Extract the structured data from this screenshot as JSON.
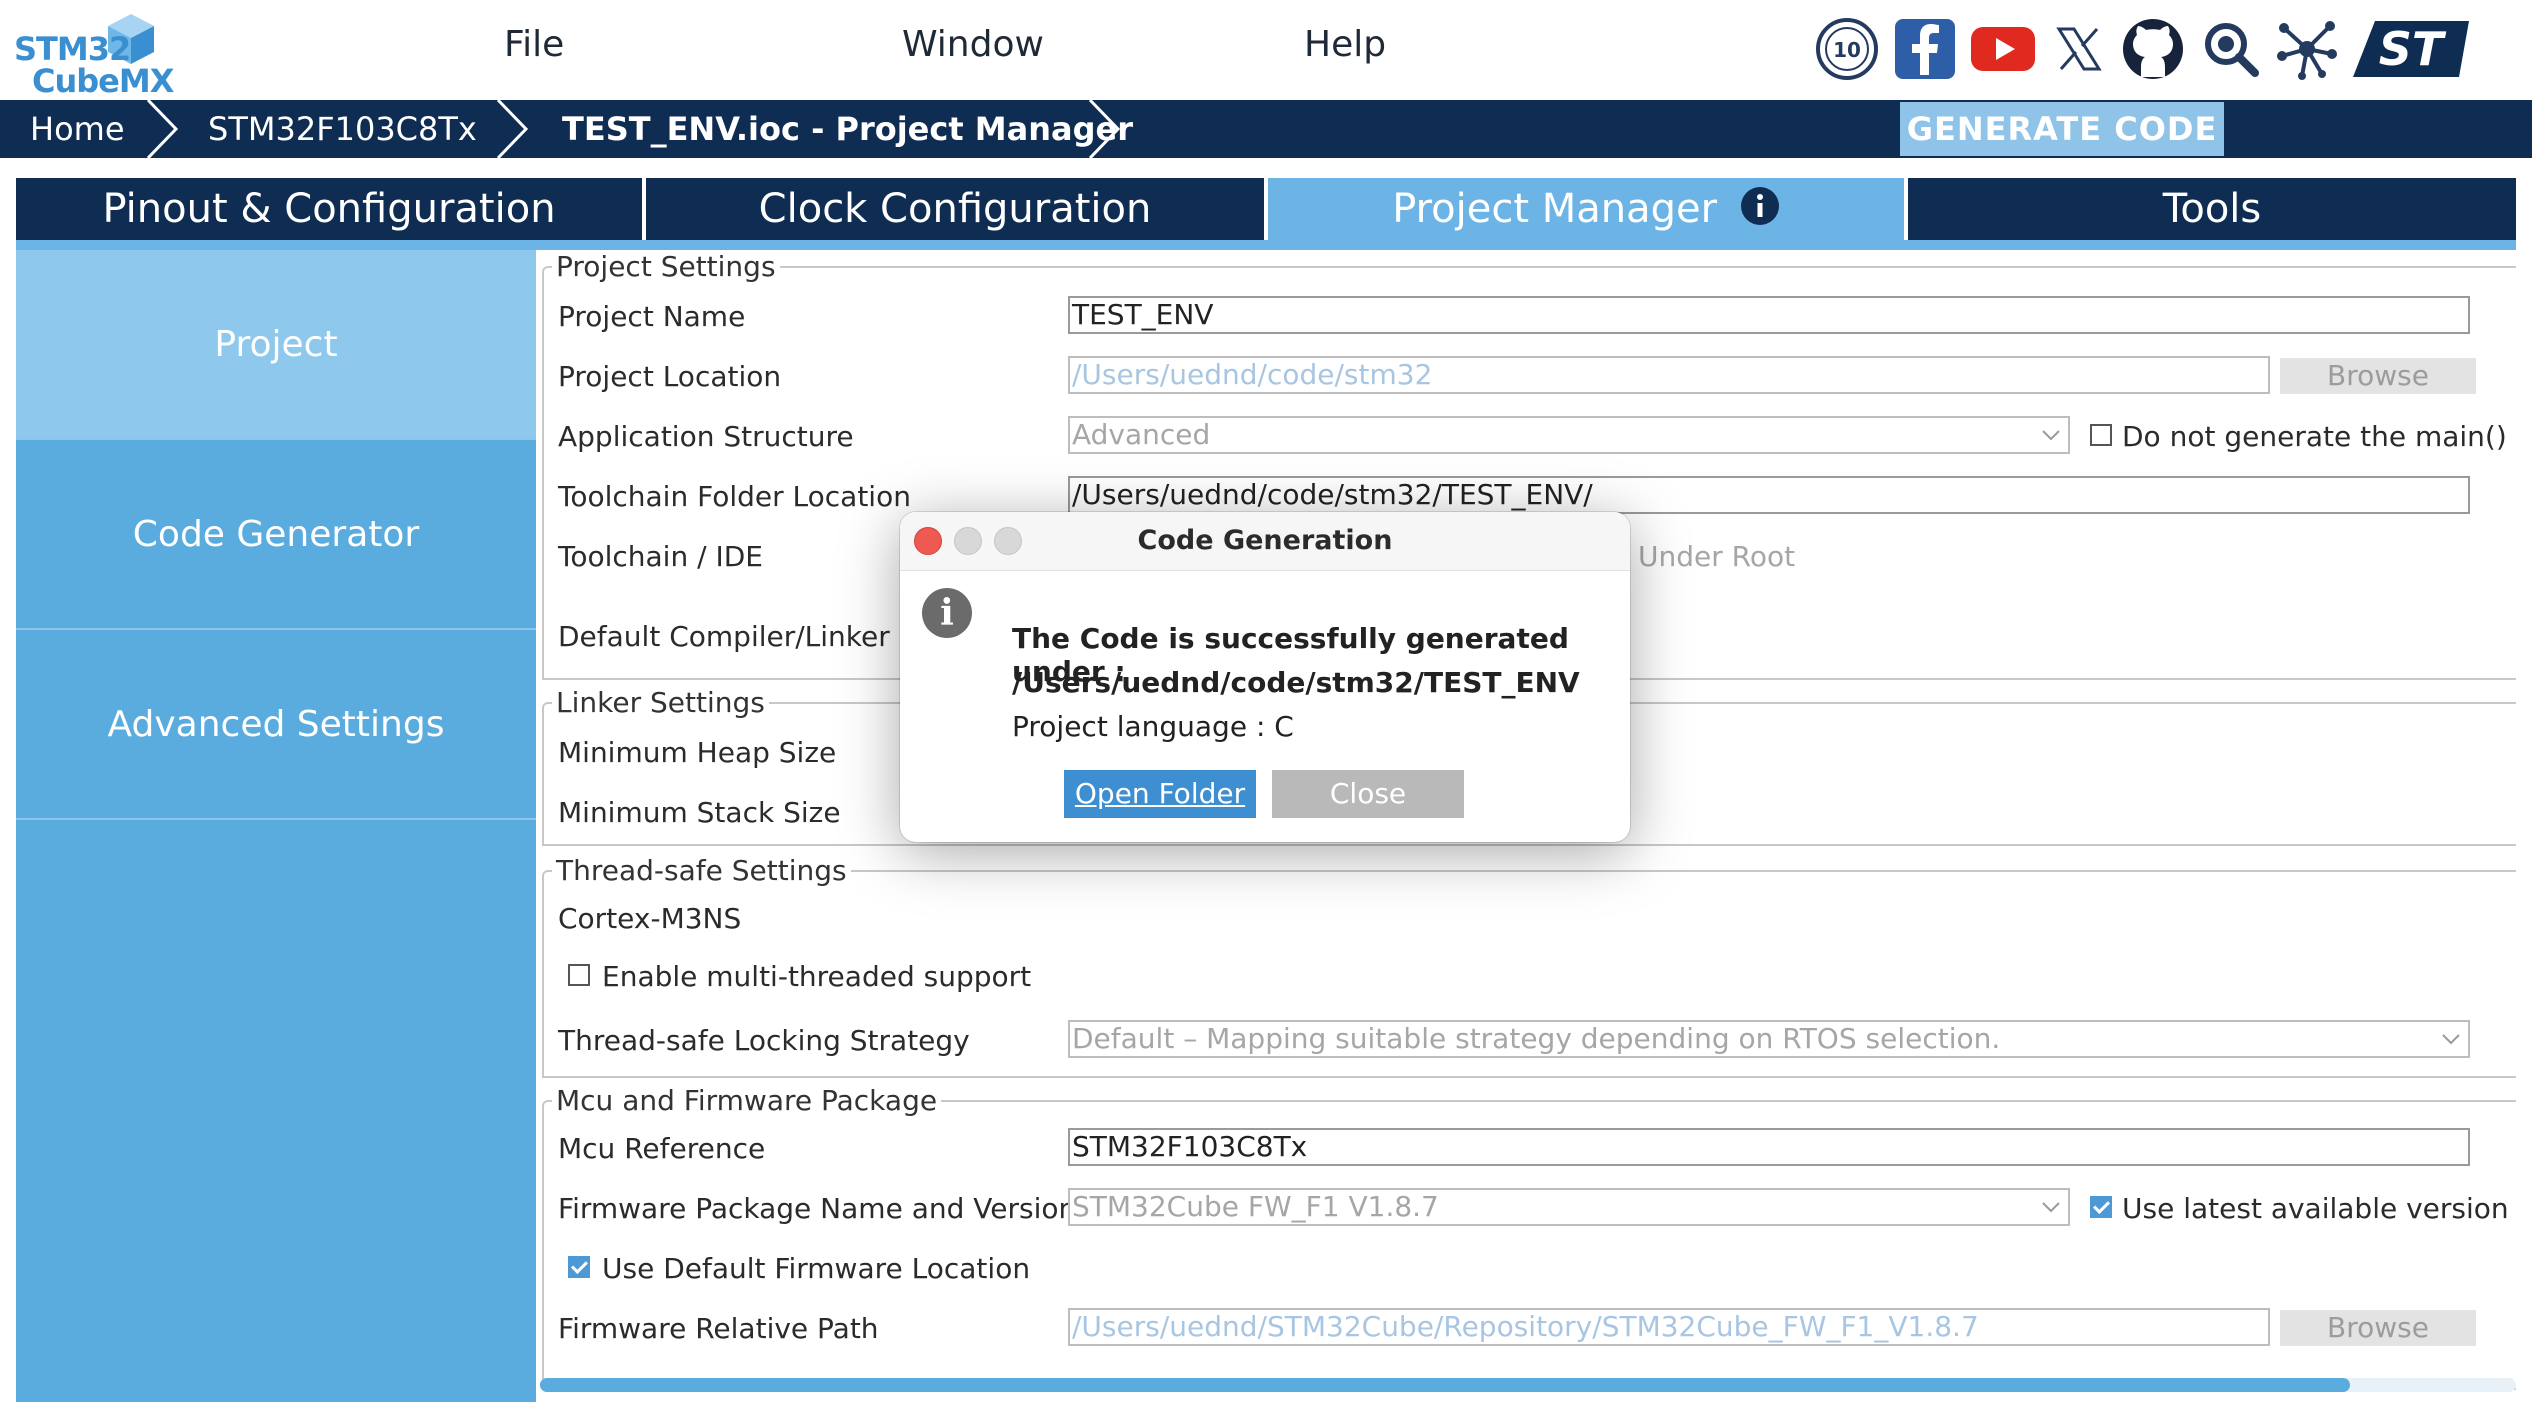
{
  "app": {
    "logo_line1": "STM32",
    "logo_line2": "CubeMX"
  },
  "menu": [
    "File",
    "Window",
    "Help"
  ],
  "social_icons": [
    "anniversary-10-icon",
    "facebook-icon",
    "youtube-icon",
    "x-icon",
    "github-icon",
    "search-community-icon",
    "network-icon",
    "st-logo-icon"
  ],
  "breadcrumb": [
    "Home",
    "STM32F103C8Tx",
    "TEST_ENV.ioc - Project Manager"
  ],
  "generate_button": "GENERATE CODE",
  "tabs": [
    {
      "label": "Pinout & Configuration",
      "active": false
    },
    {
      "label": "Clock Configuration",
      "active": false
    },
    {
      "label": "Project Manager",
      "active": true
    },
    {
      "label": "Tools",
      "active": false
    }
  ],
  "sidebar": [
    {
      "label": "Project",
      "active": true
    },
    {
      "label": "Code Generator",
      "active": false
    },
    {
      "label": "Advanced Settings",
      "active": false
    }
  ],
  "project_settings": {
    "title": "Project Settings",
    "name_label": "Project Name",
    "name_value": "TEST_ENV",
    "location_label": "Project Location",
    "location_value": "/Users/uednd/code/stm32",
    "browse_label": "Browse",
    "structure_label": "Application Structure",
    "structure_value": "Advanced",
    "no_main_label": "Do not generate the main()",
    "toolchain_folder_label": "Toolchain Folder Location",
    "toolchain_folder_value": "/Users/uednd/code/stm32/TEST_ENV/",
    "toolchain_ide_label": "Toolchain / IDE",
    "under_root_label": "Under Root",
    "compiler_label": "Default Compiler/Linker"
  },
  "linker_settings": {
    "title": "Linker Settings",
    "heap_label": "Minimum Heap Size",
    "stack_label": "Minimum Stack Size"
  },
  "thread_safe": {
    "title": "Thread-safe Settings",
    "core_label": "Cortex-M3NS",
    "multi_thread_label": "Enable multi-threaded support",
    "multi_thread_checked": false,
    "strategy_label": "Thread-safe Locking Strategy",
    "strategy_value": "Default – Mapping suitable strategy depending on RTOS selection."
  },
  "mcu_firmware": {
    "title": "Mcu and Firmware Package",
    "mcu_ref_label": "Mcu Reference",
    "mcu_ref_value": "STM32F103C8Tx",
    "fw_name_label": "Firmware Package Name and Version",
    "fw_name_value": "STM32Cube FW_F1 V1.8.7",
    "latest_label": "Use latest available version",
    "latest_checked": true,
    "default_loc_label": "Use Default Firmware Location",
    "default_loc_checked": true,
    "rel_path_label": "Firmware Relative Path",
    "rel_path_value": "/Users/uednd/STM32Cube/Repository/STM32Cube_FW_F1_V1.8.7",
    "browse_label": "Browse"
  },
  "dialog": {
    "title": "Code Generation",
    "message_line1": "The Code is successfully generated under :",
    "message_line2": "/Users/uednd/code/stm32/TEST_ENV",
    "message_line3": "Project language : C",
    "open_folder_label": "Open Folder",
    "close_label": "Close"
  },
  "colors": {
    "navy": "#0f2d52",
    "accent": "#5aacdf",
    "active_tab": "#6cb4e6",
    "dialog_button": "#3d8fd1"
  }
}
